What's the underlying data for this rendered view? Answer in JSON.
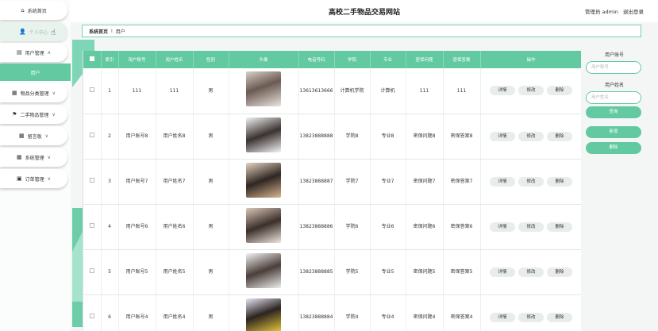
{
  "header": {
    "title": "高校二手物品交易网站",
    "admin_text": "管理员 admin",
    "logout": "退出登录"
  },
  "sidebar": {
    "items": [
      {
        "label": "系统首页",
        "icon": "home-icon"
      },
      {
        "label": "个人中心",
        "icon": "user-icon"
      },
      {
        "label": "用户管理",
        "icon": "briefcase-icon"
      },
      {
        "label": "用户"
      },
      {
        "label": "物品分类管理",
        "icon": "grid-icon"
      },
      {
        "label": "二手物品管理",
        "icon": "flag-icon"
      },
      {
        "label": "留言板",
        "icon": "grid-icon"
      },
      {
        "label": "系统管理",
        "icon": "grid-icon"
      },
      {
        "label": "订单管理",
        "icon": "print-icon"
      }
    ]
  },
  "breadcrumb": {
    "home": "系统首页",
    "separator": "I",
    "current": "用户"
  },
  "table": {
    "columns": [
      "索引",
      "用户账号",
      "用户姓名",
      "性别",
      "头像",
      "电话号码",
      "学院",
      "专业",
      "密保问题",
      "密保答案",
      "操作"
    ],
    "rows": [
      {
        "index": "1",
        "account": "111",
        "name": "111",
        "gender": "男",
        "phone": "13613613666",
        "college": "计算机学院",
        "major": "计算机",
        "question": "111",
        "answer": "111"
      },
      {
        "index": "2",
        "account": "用户账号8",
        "name": "用户姓名8",
        "gender": "男",
        "phone": "13823888888",
        "college": "学院8",
        "major": "专业8",
        "question": "密保问题8",
        "answer": "密保答案8"
      },
      {
        "index": "3",
        "account": "用户账号7",
        "name": "用户姓名7",
        "gender": "男",
        "phone": "13823888887",
        "college": "学院7",
        "major": "专业7",
        "question": "密保问题7",
        "answer": "密保答案7"
      },
      {
        "index": "4",
        "account": "用户账号6",
        "name": "用户姓名6",
        "gender": "男",
        "phone": "13823888886",
        "college": "学院6",
        "major": "专业6",
        "question": "密保问题6",
        "answer": "密保答案6"
      },
      {
        "index": "5",
        "account": "用户账号5",
        "name": "用户姓名5",
        "gender": "男",
        "phone": "13823888885",
        "college": "学院5",
        "major": "专业5",
        "question": "密保问题5",
        "answer": "密保答案5"
      },
      {
        "index": "6",
        "account": "用户账号4",
        "name": "用户姓名4",
        "gender": "男",
        "phone": "13823888884",
        "college": "学院4",
        "major": "专业4",
        "question": "密保问题4",
        "answer": "密保答案4"
      }
    ],
    "actions": {
      "detail": "详情",
      "edit": "修改",
      "delete": "删除"
    }
  },
  "search": {
    "account_label": "用户账号",
    "account_placeholder": "用户账号",
    "name_label": "用户姓名",
    "name_placeholder": "用户姓名",
    "query_button": "查询",
    "add_button": "新增",
    "delete_button": "删除"
  },
  "colors": {
    "accent": "#62c9a1",
    "accent_light": "#7fd6b6"
  }
}
